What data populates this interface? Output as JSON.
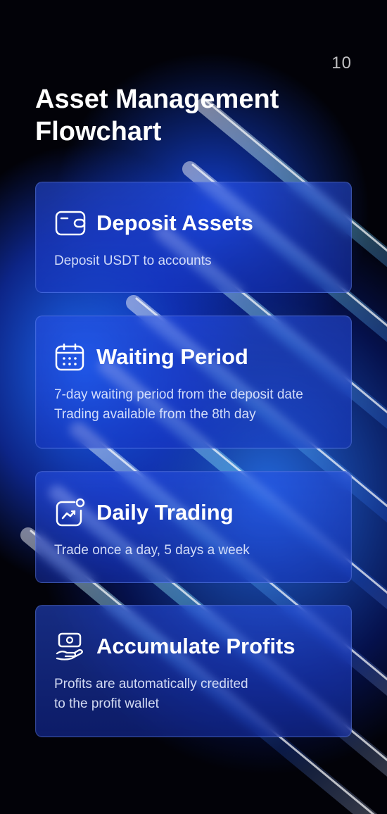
{
  "page_number": "10",
  "title": "Asset Management Flowchart",
  "steps": [
    {
      "icon": "wallet-icon",
      "title": "Deposit Assets",
      "description": [
        "Deposit USDT to accounts"
      ]
    },
    {
      "icon": "calendar-icon",
      "title": "Waiting Period",
      "description": [
        "7-day waiting period from the deposit date",
        "Trading available from the 8th day"
      ]
    },
    {
      "icon": "trend-chart-icon",
      "title": "Daily Trading",
      "description": [
        "Trade once a day, 5 days a week"
      ]
    },
    {
      "icon": "hand-money-icon",
      "title": "Accumulate Profits",
      "description": [
        "Profits are automatically credited",
        "to the profit wallet"
      ]
    }
  ]
}
